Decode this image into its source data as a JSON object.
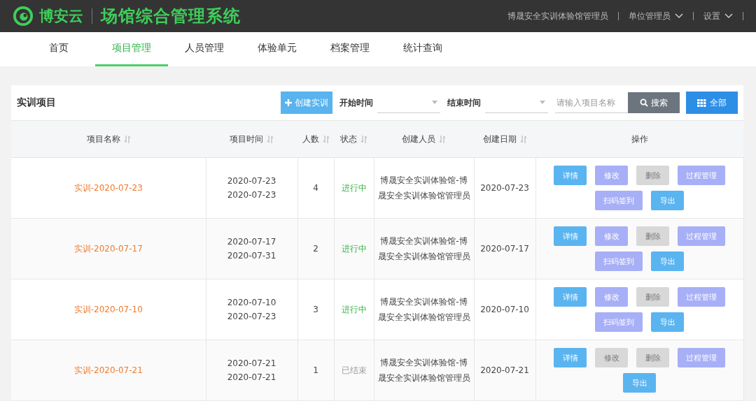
{
  "header": {
    "brand": "博安云",
    "system_title": "场馆综合管理系统",
    "user": "博晟安全实训体验馆管理员",
    "menus": [
      "单位管理员",
      "设置"
    ]
  },
  "nav": [
    {
      "label": "首页",
      "selected": false
    },
    {
      "label": "项目管理",
      "selected": true
    },
    {
      "label": "人员管理",
      "selected": false
    },
    {
      "label": "体验单元",
      "selected": false
    },
    {
      "label": "档案管理",
      "selected": false
    },
    {
      "label": "统计查询",
      "selected": false
    }
  ],
  "toolbar": {
    "title": "实训项目",
    "create_button": "创建实训",
    "start_label": "开始时间",
    "end_label": "结束时间",
    "search_placeholder": "请输入项目名称",
    "search_button": "搜索",
    "all_button": "全部"
  },
  "table": {
    "columns": [
      {
        "label": "项目名称",
        "sortable": true
      },
      {
        "label": "项目时间",
        "sortable": true
      },
      {
        "label": "人数",
        "sortable": true
      },
      {
        "label": "状态",
        "sortable": true
      },
      {
        "label": "创建人员",
        "sortable": true
      },
      {
        "label": "创建日期",
        "sortable": true
      },
      {
        "label": "操作",
        "sortable": false
      }
    ],
    "rows": [
      {
        "name": "实训-2020-07-23",
        "start": "2020-07-23",
        "end": "2020-07-23",
        "count": "4",
        "status": "进行中",
        "ended": false,
        "creator": "博晟安全实训体验馆-博晟安全实训体验馆管理员",
        "date": "2020-07-23",
        "actions": [
          {
            "label": "详情",
            "kind": "primary",
            "disabled": false
          },
          {
            "label": "修改",
            "kind": "secondary",
            "disabled": false
          },
          {
            "label": "删除",
            "disabled": true
          },
          {
            "label": "过程管理",
            "kind": "secondary",
            "disabled": false
          },
          {
            "label": "扫码签到",
            "kind": "secondary",
            "disabled": false
          },
          {
            "label": "导出",
            "kind": "primary",
            "disabled": false
          }
        ]
      },
      {
        "name": "实训-2020-07-17",
        "start": "2020-07-17",
        "end": "2020-07-31",
        "count": "2",
        "status": "进行中",
        "ended": false,
        "creator": "博晟安全实训体验馆-博晟安全实训体验馆管理员",
        "date": "2020-07-17",
        "actions": [
          {
            "label": "详情",
            "kind": "primary",
            "disabled": false
          },
          {
            "label": "修改",
            "kind": "secondary",
            "disabled": false
          },
          {
            "label": "删除",
            "disabled": true
          },
          {
            "label": "过程管理",
            "kind": "secondary",
            "disabled": false
          },
          {
            "label": "扫码签到",
            "kind": "secondary",
            "disabled": false
          },
          {
            "label": "导出",
            "kind": "primary",
            "disabled": false
          }
        ]
      },
      {
        "name": "实训-2020-07-10",
        "start": "2020-07-10",
        "end": "2020-07-23",
        "count": "3",
        "status": "进行中",
        "ended": false,
        "creator": "博晟安全实训体验馆-博晟安全实训体验馆管理员",
        "date": "2020-07-10",
        "actions": [
          {
            "label": "详情",
            "kind": "primary",
            "disabled": false
          },
          {
            "label": "修改",
            "kind": "secondary",
            "disabled": false
          },
          {
            "label": "删除",
            "disabled": true
          },
          {
            "label": "过程管理",
            "kind": "secondary",
            "disabled": false
          },
          {
            "label": "扫码签到",
            "kind": "secondary",
            "disabled": false
          },
          {
            "label": "导出",
            "kind": "primary",
            "disabled": false
          }
        ]
      },
      {
        "name": "实训-2020-07-21",
        "start": "2020-07-21",
        "end": "2020-07-21",
        "count": "1",
        "status": "已结束",
        "ended": true,
        "creator": "博晟安全实训体验馆-博晟安全实训体验馆管理员",
        "date": "2020-07-21",
        "actions": [
          {
            "label": "详情",
            "kind": "primary",
            "disabled": false
          },
          {
            "label": "修改",
            "disabled": true
          },
          {
            "label": "删除",
            "disabled": true
          },
          {
            "label": "过程管理",
            "kind": "secondary",
            "disabled": false
          },
          {
            "label": "导出",
            "kind": "primary",
            "disabled": false
          }
        ]
      }
    ]
  }
}
